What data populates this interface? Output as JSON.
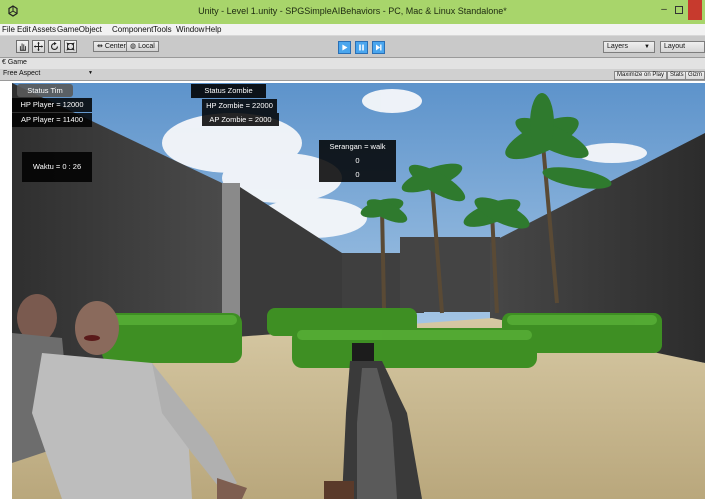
{
  "window": {
    "title": "Unity - Level 1.unity - SPGSimpleAIBehaviors - PC, Mac & Linux Standalone*"
  },
  "menu": [
    "File",
    "Edit",
    "Assets",
    "GameObject",
    "Component",
    "Tools",
    "Window",
    "Help"
  ],
  "toolbar": {
    "center_label": "Center",
    "local_label": "Local",
    "layers_label": "Layers",
    "layout_label": "Layout"
  },
  "game_tab": {
    "tab_label": "Game",
    "aspect": "Free Aspect",
    "maximize_label": "Maximize on Play",
    "stats_label": "Stats",
    "gizmos_label": "Gizm"
  },
  "hud": {
    "player_status_title": "Status Tim",
    "player_hp": "HP  Player = 12000",
    "player_ap": "AP  Player = 11400",
    "zombie_status_title": "Status Zombie",
    "zombie_hp": "HP  Zombie = 22000",
    "zombie_ap": "AP  Zombie = 2000",
    "attack_label": "Serangan = walk",
    "attack_value_1": "0",
    "attack_value_2": "0",
    "timer": "Waktu =  0 : 26"
  },
  "colors": {
    "titlebar": "#a8d56b",
    "play_active": "#4aa6ee",
    "close_button": "#c73a2d"
  },
  "icons": {
    "hand_tool": "hand-icon",
    "move_tool": "move-icon",
    "rotate_tool": "rotate-icon",
    "scale_tool": "scale-icon",
    "play": "play-icon",
    "pause": "pause-icon",
    "step": "step-icon"
  }
}
